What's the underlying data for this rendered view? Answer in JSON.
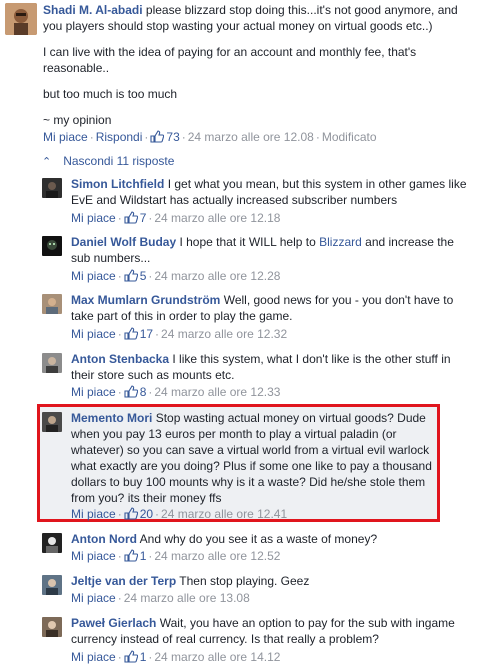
{
  "top_comment": {
    "author": "Shadi M. Al-abadi",
    "text1": "please blizzard stop doing this...it's not good anymore, and you players should stop wasting your actual money on virtual goods etc..)",
    "text2": "I can live with the idea of paying for an account and monthly fee, that's reasonable..",
    "text3": "but too much is too much",
    "text4": "~ my opinion",
    "like_label": "Mi piace",
    "reply_label": "Rispondi",
    "like_count": "73",
    "time": "24 marzo alle ore 12.08",
    "edited": "Modificato"
  },
  "hide_replies_label": "Nascondi 11 risposte",
  "replies": [
    {
      "author": "Simon Litchfield",
      "text": "I get what you mean, but this system in other games like EvE and Wildstart has actually increased subscriber numbers",
      "like_label": "Mi piace",
      "like_count": "7",
      "time": "24 marzo alle ore 12.18"
    },
    {
      "author": "Daniel Wolf Buday",
      "text_before": "I hope that it WILL help to",
      "link": "Blizzard",
      "text_after": "and increase the sub numbers...",
      "like_label": "Mi piace",
      "like_count": "5",
      "time": "24 marzo alle ore 12.28"
    },
    {
      "author": "Max Mumlarn Grundström",
      "text": "Well, good news for you - you don't have to take part of this in order to play the game.",
      "like_label": "Mi piace",
      "like_count": "17",
      "time": "24 marzo alle ore 12.32"
    },
    {
      "author": "Anton Stenbacka",
      "text": "I like this system, what I don't like is the other stuff in their store such as mounts etc.",
      "like_label": "Mi piace",
      "like_count": "8",
      "time": "24 marzo alle ore 12.33"
    },
    {
      "author": "Memento Mori",
      "text": "Stop wasting actual money on virtual goods? Dude when you pay 13 euros per month to play a virtual paladin (or whatever) so you can save a virtual world from a virtual evil warlock what exactly are you doing? Plus if some one like to pay a thousand dollars to buy 100 mounts why is it a waste? Did he/she stole them from you? its their money ffs",
      "like_label": "Mi piace",
      "like_count": "20",
      "time": "24 marzo alle ore 12.41"
    },
    {
      "author": "Anton Nord",
      "text": "And why do you see it as a waste of money?",
      "like_label": "Mi piace",
      "like_count": "1",
      "time": "24 marzo alle ore 12.52"
    },
    {
      "author": "Jeltje van der Terp",
      "text": "Then stop playing. Geez",
      "like_label": "Mi piace",
      "time": "24 marzo alle ore 13.08"
    },
    {
      "author": "Paweł Gierlach",
      "text": "Wait, you have an option to pay for the sub with ingame currency instead of real currency. Is that really a problem?",
      "like_label": "Mi piace",
      "like_count": "1",
      "time": "24 marzo alle ore 14.12"
    }
  ],
  "colors": {
    "link": "#365899",
    "meta": "#90949c",
    "highlight_border": "#e0151d"
  }
}
